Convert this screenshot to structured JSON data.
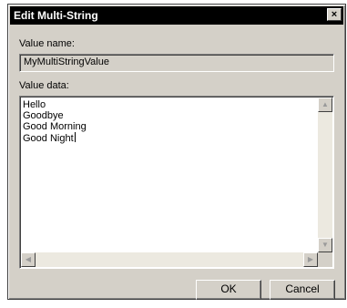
{
  "dialog": {
    "title": "Edit Multi-String",
    "close_glyph": "×"
  },
  "value_name": {
    "label": "Value name:",
    "value": "MyMultiStringValue"
  },
  "value_data": {
    "label": "Value data:",
    "lines": [
      "Hello",
      "Goodbye",
      "Good Morning",
      "Good Night"
    ]
  },
  "scroll": {
    "up_glyph": "▲",
    "down_glyph": "▼",
    "left_glyph": "◀",
    "right_glyph": "▶"
  },
  "buttons": {
    "ok_label": "OK",
    "cancel_label": "Cancel"
  }
}
